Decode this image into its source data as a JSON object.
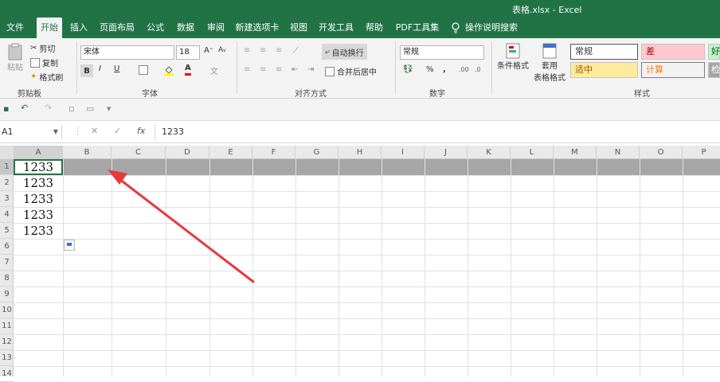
{
  "window": {
    "title": "表格.xlsx  -  Excel"
  },
  "tabs": [
    "文件",
    "开始",
    "插入",
    "页面布局",
    "公式",
    "数据",
    "审阅",
    "新建选项卡",
    "视图",
    "开发工具",
    "帮助",
    "PDF工具集",
    "操作说明搜索"
  ],
  "clipboard": {
    "paste": "粘贴",
    "cut": "剪切",
    "copy": "复制",
    "format_painter": "格式刷",
    "label": "剪贴板"
  },
  "font": {
    "name": "宋体",
    "size": "18",
    "bold": "B",
    "italic": "I",
    "underline": "U",
    "label": "字体"
  },
  "alignment": {
    "wrap": "自动换行",
    "merge": "合并后居中",
    "label": "对齐方式"
  },
  "number": {
    "format": "常规",
    "percent": "%",
    "comma": ",",
    "label": "数字"
  },
  "styles": {
    "conditional": "条件格式",
    "table_line1": "套用",
    "table_line2": "表格格式",
    "normal": "常规",
    "bad": "差",
    "good": "好",
    "neutral": "适中",
    "calc": "计算",
    "check": "检",
    "label": "样式"
  },
  "formula_bar": {
    "name_box": "A1",
    "fx": "fx",
    "value": "1233"
  },
  "columns": [
    "A",
    "B",
    "C",
    "D",
    "E",
    "F",
    "G",
    "H",
    "I",
    "J",
    "K",
    "L",
    "M",
    "N",
    "O",
    "P"
  ],
  "rows": [
    "1",
    "2",
    "3",
    "4",
    "5",
    "6",
    "7",
    "8",
    "9",
    "10",
    "11",
    "12",
    "13",
    "14"
  ],
  "cells": [
    "1233",
    "1233",
    "1233",
    "1233",
    "1233"
  ],
  "colors": {
    "brand": "#217346",
    "annotation_arrow": "#e8383c"
  }
}
